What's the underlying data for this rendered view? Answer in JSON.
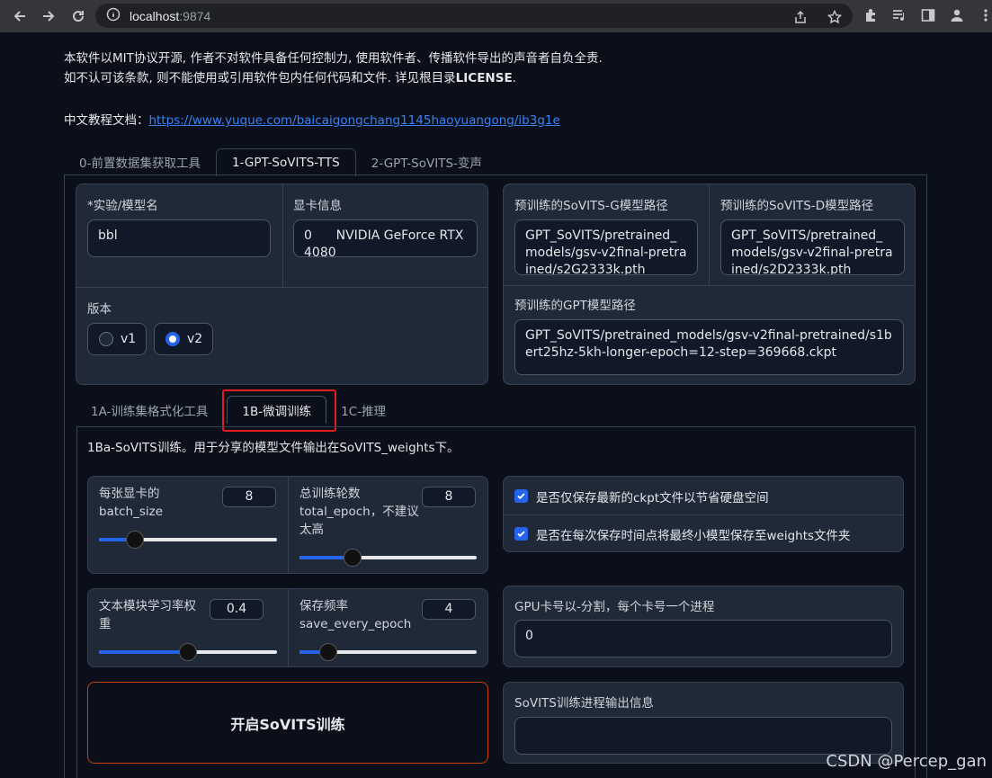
{
  "browser": {
    "url_host": "localhost",
    "url_port": ":9874"
  },
  "intro": {
    "line1": "本软件以MIT协议开源, 作者不对软件具备任何控制力, 使用软件者、传播软件导出的声音者自负全责.",
    "line2_prefix": "如不认可该条款, 则不能使用或引用软件包内任何代码和文件. 详见根目录",
    "line2_bold": "LICENSE",
    "line2_suffix": ".",
    "doc_label": "中文教程文档：",
    "doc_link": "https://www.yuque.com/baicaigongchang1145haoyuangong/ib3g1e"
  },
  "top_tabs": [
    "0-前置数据集获取工具",
    "1-GPT-SoVITS-TTS",
    "2-GPT-SoVITS-变声"
  ],
  "config": {
    "exp_name_label": "*实验/模型名",
    "exp_name_value": "bbl",
    "gpu_info_label": "显卡信息",
    "gpu_info_value": "0\tNVIDIA GeForce RTX 4080",
    "version_label": "版本",
    "version_options": [
      "v1",
      "v2"
    ],
    "version_selected": "v2",
    "pretrained_g_label": "预训练的SoVITS-G模型路径",
    "pretrained_g_value": "GPT_SoVITS/pretrained_models/gsv-v2final-pretrained/s2G2333k.pth",
    "pretrained_d_label": "预训练的SoVITS-D模型路径",
    "pretrained_d_value": "GPT_SoVITS/pretrained_models/gsv-v2final-pretrained/s2D2333k.pth",
    "pretrained_gpt_label": "预训练的GPT模型路径",
    "pretrained_gpt_value": "GPT_SoVITS/pretrained_models/gsv-v2final-pretrained/s1bert25hz-5kh-longer-epoch=12-step=369668.ckpt"
  },
  "sub_tabs": [
    "1A-训练集格式化工具",
    "1B-微调训练",
    "1C-推理"
  ],
  "sovits": {
    "desc": "1Ba-SoVITS训练。用于分享的模型文件输出在SoVITS_weights下。",
    "batch_label": "每张显卡的\nbatch_size",
    "batch_value": "8",
    "batch_fraction": 0.2,
    "epoch_label": "总训练轮数\ntotal_epoch，不建议\n太高",
    "epoch_value": "8",
    "epoch_fraction": 0.3,
    "text_lr_label": "文本模块学习率权\n重",
    "text_lr_value": "0.4",
    "text_lr_fraction": 0.5,
    "save_freq_label": "保存频率\nsave_every_epoch",
    "save_freq_value": "4",
    "save_freq_fraction": 0.16,
    "chk1_label": "是否仅保存最新的ckpt文件以节省硬盘空间",
    "chk2_label": "是否在每次保存时间点将最终小模型保存至weights文件夹",
    "gpu_ids_label": "GPU卡号以-分割，每个卡号一个进程",
    "gpu_ids_value": "0",
    "start_btn": "开启SoVITS训练",
    "output_label": "SoVITS训练进程输出信息"
  },
  "watermark": "CSDN @Percep_gan"
}
